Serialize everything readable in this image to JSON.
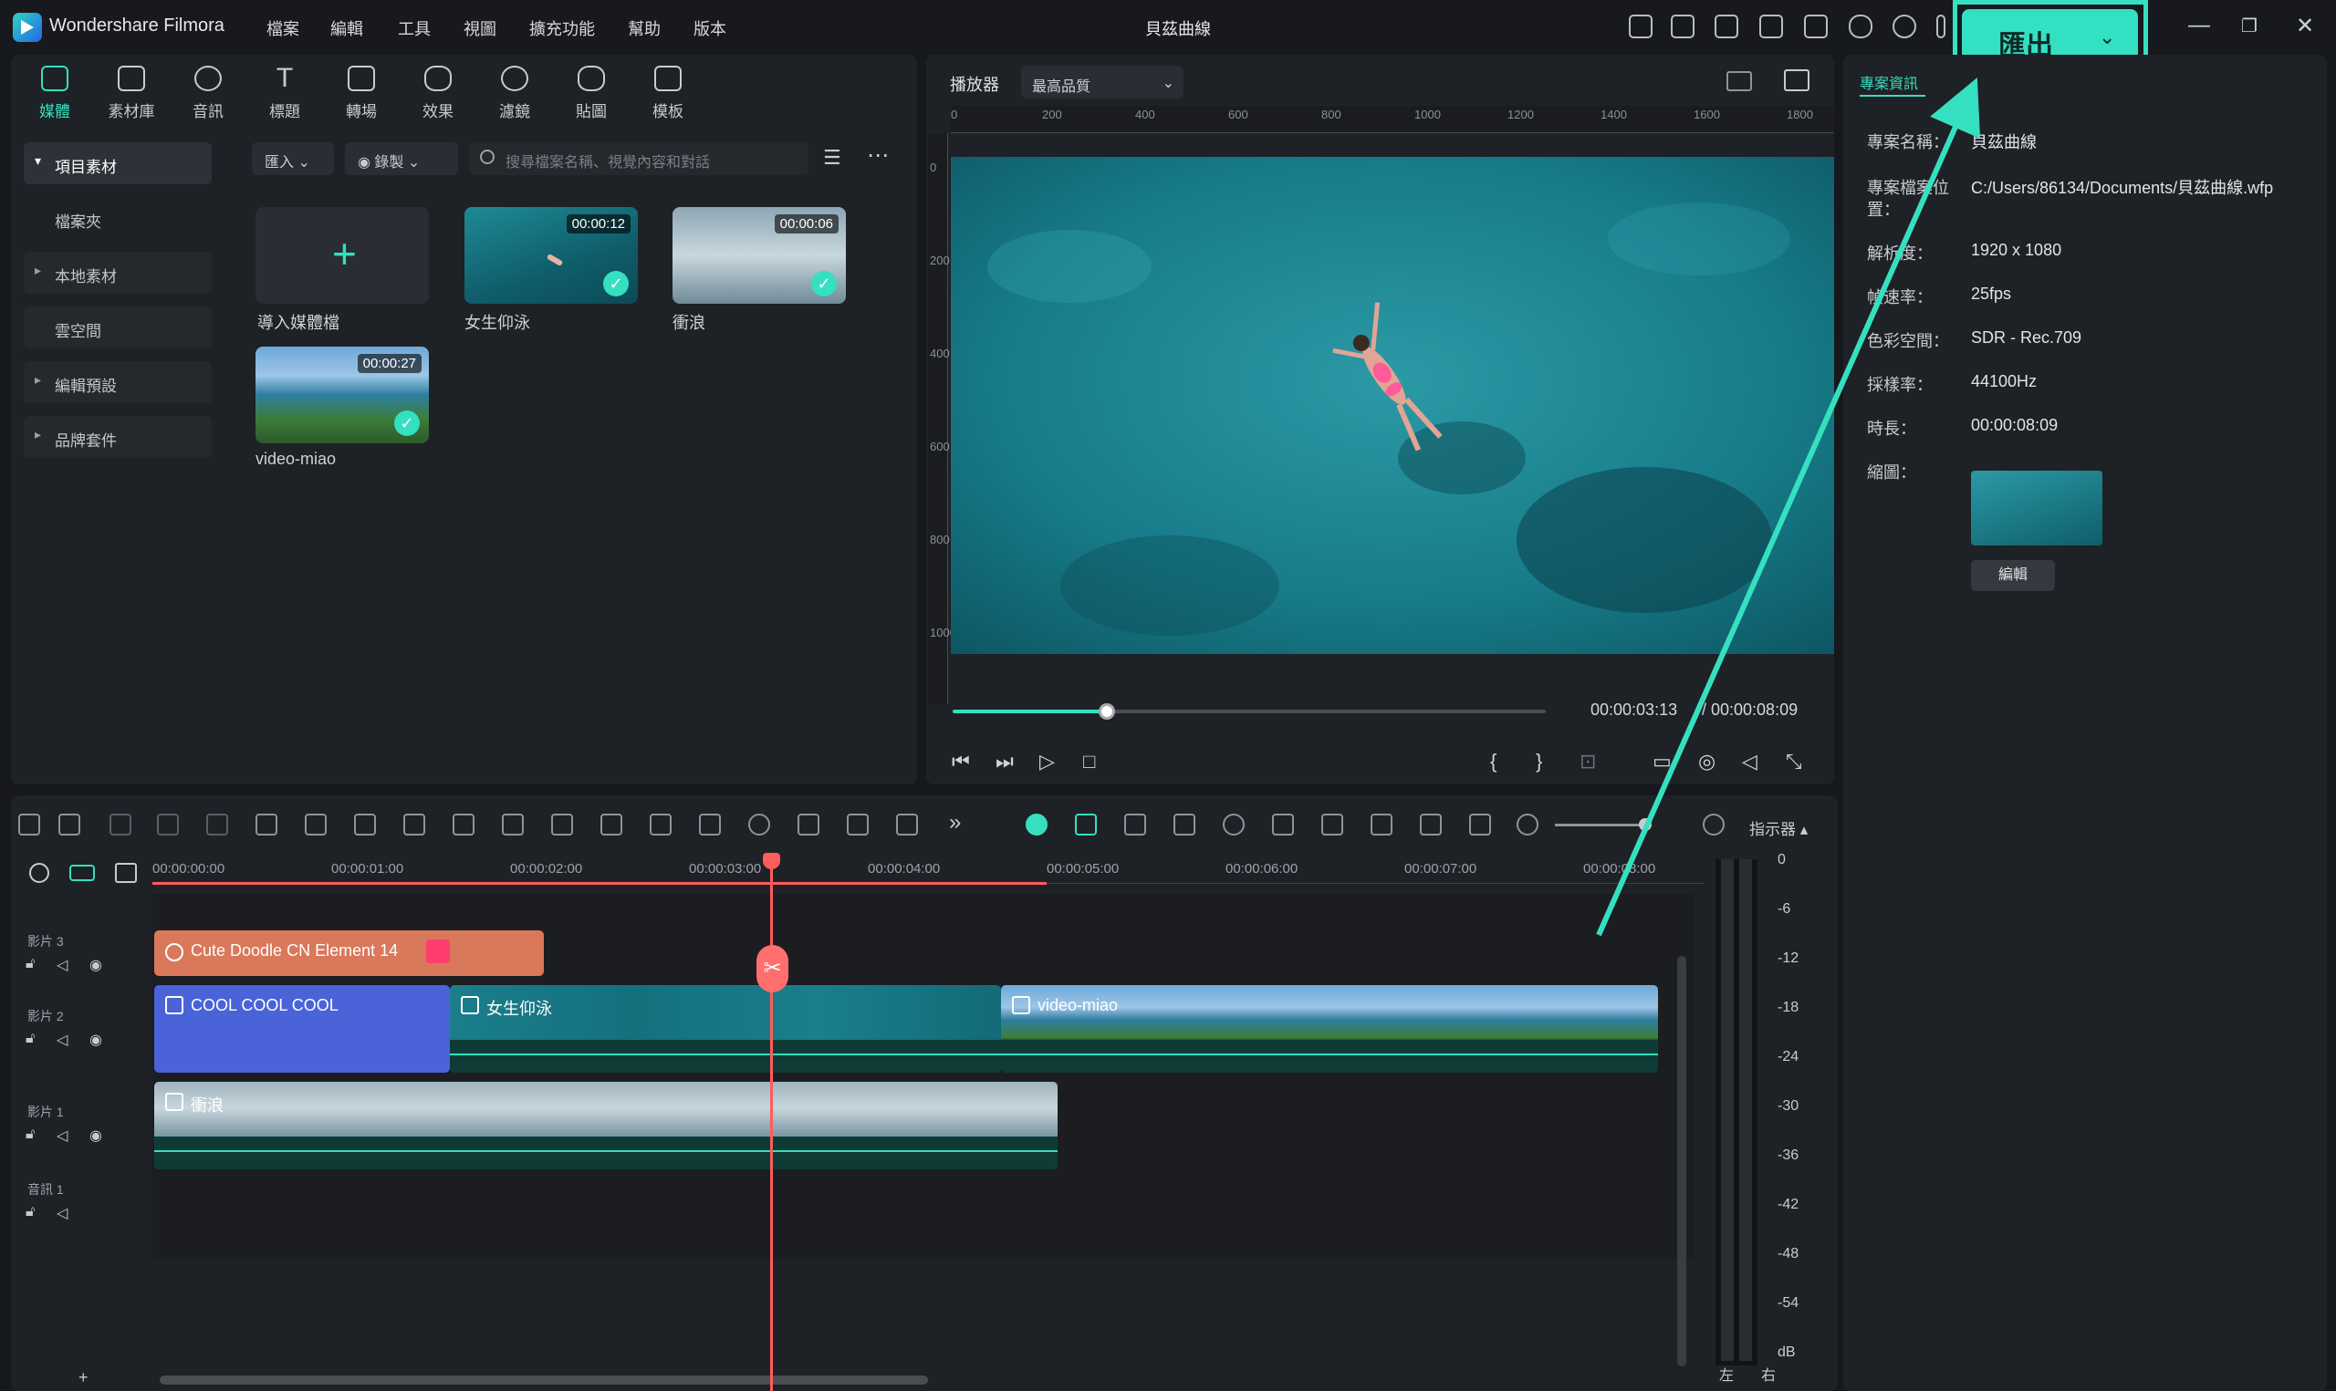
{
  "app": {
    "name": "Wondershare Filmora",
    "project_title": "貝茲曲線"
  },
  "menu": [
    "檔案",
    "編輯",
    "工具",
    "視圖",
    "擴充功能",
    "幫助",
    "版本"
  ],
  "export": {
    "label": "匯出"
  },
  "media_tabs": [
    "媒體",
    "素材庫",
    "音訊",
    "標題",
    "轉場",
    "效果",
    "濾鏡",
    "貼圖",
    "模板"
  ],
  "sidebar": [
    "項目素材",
    "檔案夾",
    "本地素材",
    "雲空間",
    "編輯預設",
    "品牌套件"
  ],
  "media_toolbar": {
    "import": "匯入",
    "record": "錄製",
    "search_placeholder": "搜尋檔案名稱、視覺內容和對話"
  },
  "media_items": [
    {
      "name": "導入媒體檔"
    },
    {
      "name": "女生仰泳",
      "duration": "00:00:12"
    },
    {
      "name": "衝浪",
      "duration": "00:00:06"
    },
    {
      "name": "video-miao",
      "duration": "00:00:27"
    }
  ],
  "player": {
    "label": "播放器",
    "quality": "最高品質",
    "ruler_h": [
      "0",
      "200",
      "400",
      "600",
      "800",
      "1000",
      "1200",
      "1400",
      "1600",
      "1800"
    ],
    "ruler_v": [
      "0",
      "200",
      "400",
      "600",
      "800",
      "1000"
    ],
    "current": "00:00:03:13",
    "total": "/ 00:00:08:09",
    "progress": 0.26
  },
  "info": {
    "tab": "專案資訊",
    "rows": [
      {
        "k": "專案名稱：",
        "v": "貝茲曲線"
      },
      {
        "k": "專案檔案位",
        "v": "C:/Users/86134/Documents/貝茲曲線.wfp"
      },
      {
        "k": "置：",
        "v": ""
      },
      {
        "k": "解析度：",
        "v": "1920 x 1080"
      },
      {
        "k": "幀速率：",
        "v": "25fps"
      },
      {
        "k": "色彩空間：",
        "v": "SDR - Rec.709"
      },
      {
        "k": "採樣率：",
        "v": "44100Hz"
      },
      {
        "k": "時長：",
        "v": "00:00:08:09"
      },
      {
        "k": "縮圖：",
        "v": ""
      }
    ],
    "edit": "編輯"
  },
  "timeline": {
    "indicator": "指示器",
    "ticks": [
      "00:00:00:00",
      "00:00:01:00",
      "00:00:02:00",
      "00:00:03:00",
      "00:00:04:00",
      "00:00:05:00",
      "00:00:06:00",
      "00:00:07:00",
      "00:00:08:00"
    ],
    "tracks": [
      "影片 3",
      "影片 2",
      "影片 1",
      "音訊 1"
    ],
    "clips": {
      "sticker": "Cute Doodle CN Element 14",
      "title": "COOL COOL COOL",
      "video_a": "女生仰泳",
      "video_b": "video-miao",
      "video_c": "衝浪"
    },
    "db": [
      "0",
      "-6",
      "-12",
      "-18",
      "-24",
      "-30",
      "-36",
      "-42",
      "-48",
      "-54",
      "dB"
    ],
    "lr": [
      "左",
      "右"
    ]
  },
  "colors": {
    "accent": "#35e0c0",
    "playhead": "#ff5c5c",
    "sticker": "#d9785a",
    "title_clip": "#4a63d8"
  }
}
